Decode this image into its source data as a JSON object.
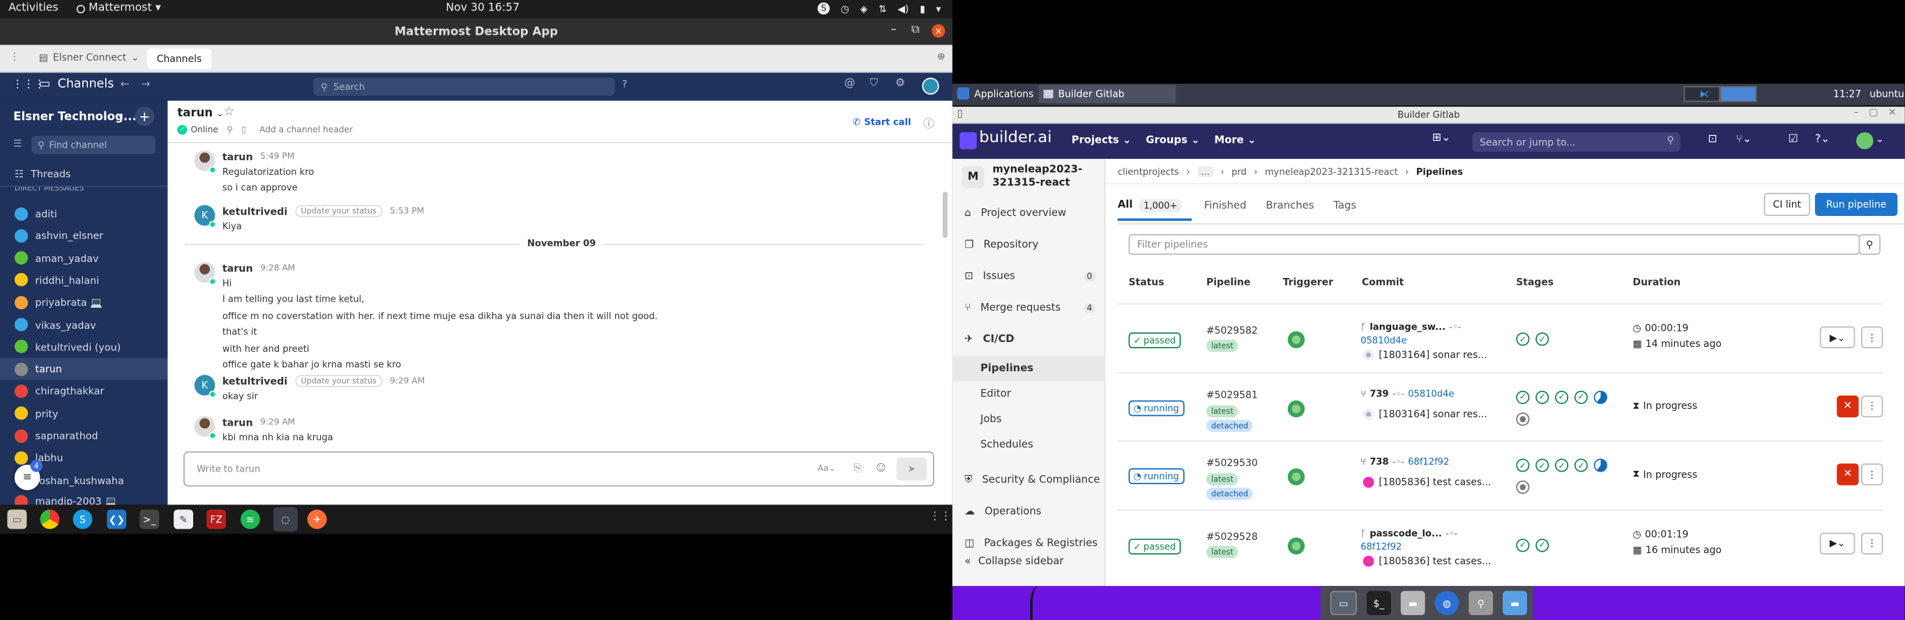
{
  "ubuntu_bar": {
    "activities": "Activities",
    "app_menu": "Mattermost",
    "clock": "Nov 30  16:57"
  },
  "mattermost": {
    "window_title": "Mattermost Desktop App",
    "tabs": {
      "server": "Elsner Connect",
      "active": "Channels"
    },
    "header": {
      "product": "Channels",
      "search_placeholder": "Search"
    },
    "sidebar": {
      "team": "Elsner Technolog...",
      "find_placeholder": "Find channel",
      "threads": "Threads",
      "section": "DIRECT MESSAGES",
      "items": [
        {
          "name": "aditi",
          "color": "#3aa6e8"
        },
        {
          "name": "ashvin_elsner",
          "color": "#3aa6e8"
        },
        {
          "name": "aman_yadav",
          "color": "#5bc236"
        },
        {
          "name": "riddhi_halani",
          "color": "#f5c518"
        },
        {
          "name": "priyabrata 💻",
          "color": "#f0a23a"
        },
        {
          "name": "vikas_yadav",
          "color": "#3aa6e8"
        },
        {
          "name": "ketultrivedi (you)",
          "color": "#5bc236"
        },
        {
          "name": "tarun",
          "color": "#8a8a8a"
        },
        {
          "name": "chiragthakkar",
          "color": "#e8453a"
        },
        {
          "name": "prity",
          "color": "#f5c518"
        },
        {
          "name": "sapnarathod",
          "color": "#e8453a"
        },
        {
          "name": "labhu",
          "color": "#f5c518"
        },
        {
          "name": "roshan_kushwaha",
          "color": "#3aa6e8"
        },
        {
          "name": "mandip-2003 💻",
          "color": "#e8453a"
        }
      ],
      "unread_badge": "4"
    },
    "channel": {
      "name": "tarun",
      "status": "Online",
      "add_header": "Add a channel header",
      "start_call": "Start call",
      "date_divider": "November 09",
      "input_placeholder": "Write to tarun",
      "messages": [
        {
          "author": "tarun",
          "time": "5:49 PM",
          "lines": [
            "Regulatorization kro",
            "so i can approve"
          ]
        },
        {
          "author": "ketultrivedi",
          "status": "Update your status",
          "time": "5:53 PM",
          "lines": [
            "Kiya"
          ]
        },
        {
          "author": "tarun",
          "time": "9:28 AM",
          "lines": [
            "Hi",
            "I am telling you last time ketul,",
            "office m no coverstation with her. if next time muje esa dikha ya sunai dia then it will not good.",
            "that's it",
            "with her and preeti",
            "office gate k bahar jo krna masti se kro"
          ]
        },
        {
          "author": "ketultrivedi",
          "status": "Update your status",
          "time": "9:29 AM",
          "lines": [
            "okay sir"
          ]
        },
        {
          "author": "tarun",
          "time": "9:29 AM",
          "lines": [
            "kbi mna nh kia na kruga"
          ]
        }
      ]
    }
  },
  "xfce": {
    "applications": "Applications",
    "task": "Builder Gitlab",
    "clock": "11:27",
    "user": "ubuntu"
  },
  "gitlab": {
    "window_title": "Builder Gitlab",
    "logo": "builder.ai",
    "nav": [
      "Projects",
      "Groups",
      "More"
    ],
    "search_placeholder": "Search or jump to...",
    "project": {
      "initial": "M",
      "name": "myneleap2023-321315-react"
    },
    "sidebar": [
      {
        "label": "Project overview",
        "icon": "home-icon"
      },
      {
        "label": "Repository",
        "icon": "book-icon"
      },
      {
        "label": "Issues",
        "count": "0",
        "icon": "issues-icon"
      },
      {
        "label": "Merge requests",
        "count": "4",
        "icon": "merge-icon"
      },
      {
        "label": "CI/CD",
        "icon": "rocket-icon",
        "active": true
      }
    ],
    "cicd_sub": [
      "Pipelines",
      "Editor",
      "Jobs",
      "Schedules"
    ],
    "sidebar_more": [
      {
        "label": "Security & Compliance",
        "icon": "shield-icon"
      },
      {
        "label": "Operations",
        "icon": "cloud-icon"
      },
      {
        "label": "Packages & Registries",
        "icon": "package-icon"
      }
    ],
    "collapse": "Collapse sidebar",
    "breadcrumb": [
      "clientprojects",
      "...",
      "prd",
      "myneleap2023-321315-react",
      "Pipelines"
    ],
    "tabs": {
      "all": "All",
      "all_count": "1,000+",
      "finished": "Finished",
      "branches": "Branches",
      "tags": "Tags"
    },
    "buttons": {
      "ci_lint": "CI lint",
      "run_pipeline": "Run pipeline"
    },
    "filter_placeholder": "Filter pipelines",
    "columns": [
      "Status",
      "Pipeline",
      "Triggerer",
      "Commit",
      "Stages",
      "Duration"
    ],
    "pipelines": [
      {
        "status": "passed",
        "id": "#5029582",
        "tags": [
          "latest"
        ],
        "ref_icon": "branch",
        "ref": "language_sw...",
        "sha": "05810d4e",
        "message": "[1803164] sonar res...",
        "stages": [
          "ok",
          "ok"
        ],
        "duration": "00:00:19",
        "finished": "14 minutes ago"
      },
      {
        "status": "running",
        "id": "#5029581",
        "tags": [
          "latest",
          "detached"
        ],
        "ref_icon": "mr",
        "ref": "739",
        "sha": "05810d4e",
        "message": "[1803164] sonar res...",
        "stages": [
          "ok",
          "ok",
          "ok",
          "ok",
          "run",
          "skip"
        ],
        "duration": "In progress"
      },
      {
        "status": "running",
        "id": "#5029530",
        "tags": [
          "latest",
          "detached"
        ],
        "ref_icon": "mr",
        "ref": "738",
        "sha": "68f12f92",
        "message": "[1805836] test cases...",
        "stages": [
          "ok",
          "ok",
          "ok",
          "ok",
          "run",
          "skip"
        ],
        "duration": "In progress"
      },
      {
        "status": "passed",
        "id": "#5029528",
        "tags": [
          "latest"
        ],
        "ref_icon": "branch",
        "ref": "passcode_lo...",
        "sha": "68f12f92",
        "message": "[1805836] test cases...",
        "stages": [
          "ok",
          "ok"
        ],
        "duration": "00:01:19",
        "finished": "16 minutes ago"
      }
    ]
  },
  "colors": {
    "mm_sidebar": "#1e325c",
    "gl_blue": "#1068bf",
    "gl_green": "#108548",
    "xfce_desktop": "#6d13e0"
  }
}
